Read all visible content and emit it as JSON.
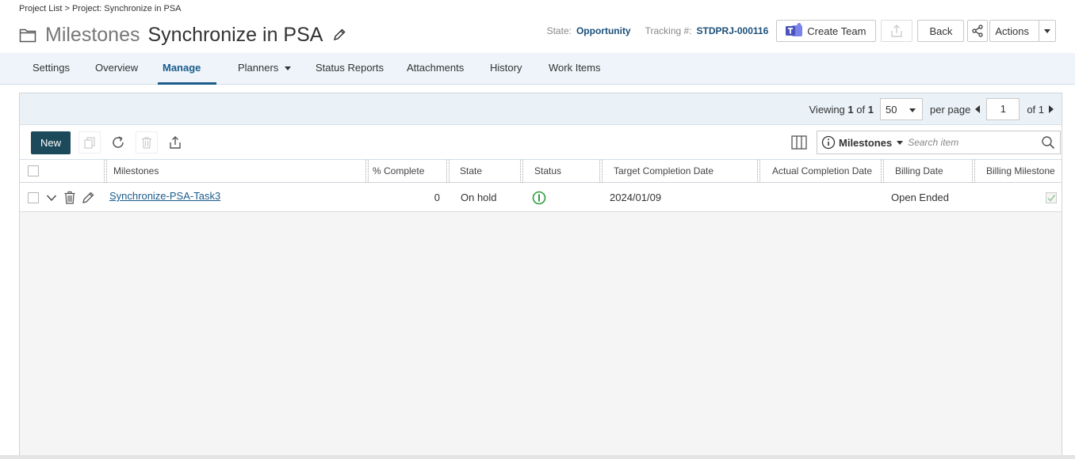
{
  "breadcrumb": "Project List > Project: Synchronize in PSA",
  "title": {
    "prefix": "Milestones",
    "name": "Synchronize in PSA"
  },
  "meta": {
    "state_label": "State:",
    "state_value": "Opportunity",
    "tracking_label": "Tracking #:",
    "tracking_value": "STDPRJ-000116"
  },
  "header_buttons": {
    "create_team": "Create Team",
    "back": "Back",
    "actions": "Actions"
  },
  "nav": [
    "Settings",
    "Overview",
    "Manage",
    "Planners",
    "Status Reports",
    "Attachments",
    "History",
    "Work Items"
  ],
  "pager": {
    "viewing": "Viewing",
    "current": "1",
    "of_label": "of",
    "total": "1",
    "per_page_value": "50",
    "per_page_label": "per page",
    "page": "1",
    "of_pages": "of 1"
  },
  "toolbar": {
    "new_label": "New"
  },
  "search": {
    "scope": "Milestones",
    "placeholder": "Search item"
  },
  "columns": [
    "Milestones",
    "% Complete",
    "State",
    "Status",
    "Target Completion Date",
    "Actual Completion Date",
    "Billing Date",
    "Billing Milestone"
  ],
  "rows": [
    {
      "milestone": "Synchronize-PSA-Task3",
      "complete": "0",
      "state": "On hold",
      "target": "2024/01/09",
      "actual": "",
      "billing_date": "Open Ended"
    }
  ],
  "colors": {
    "accent": "#1a5b8c",
    "new_button": "#1c4a5a",
    "status_ok": "#2e9e3e"
  }
}
